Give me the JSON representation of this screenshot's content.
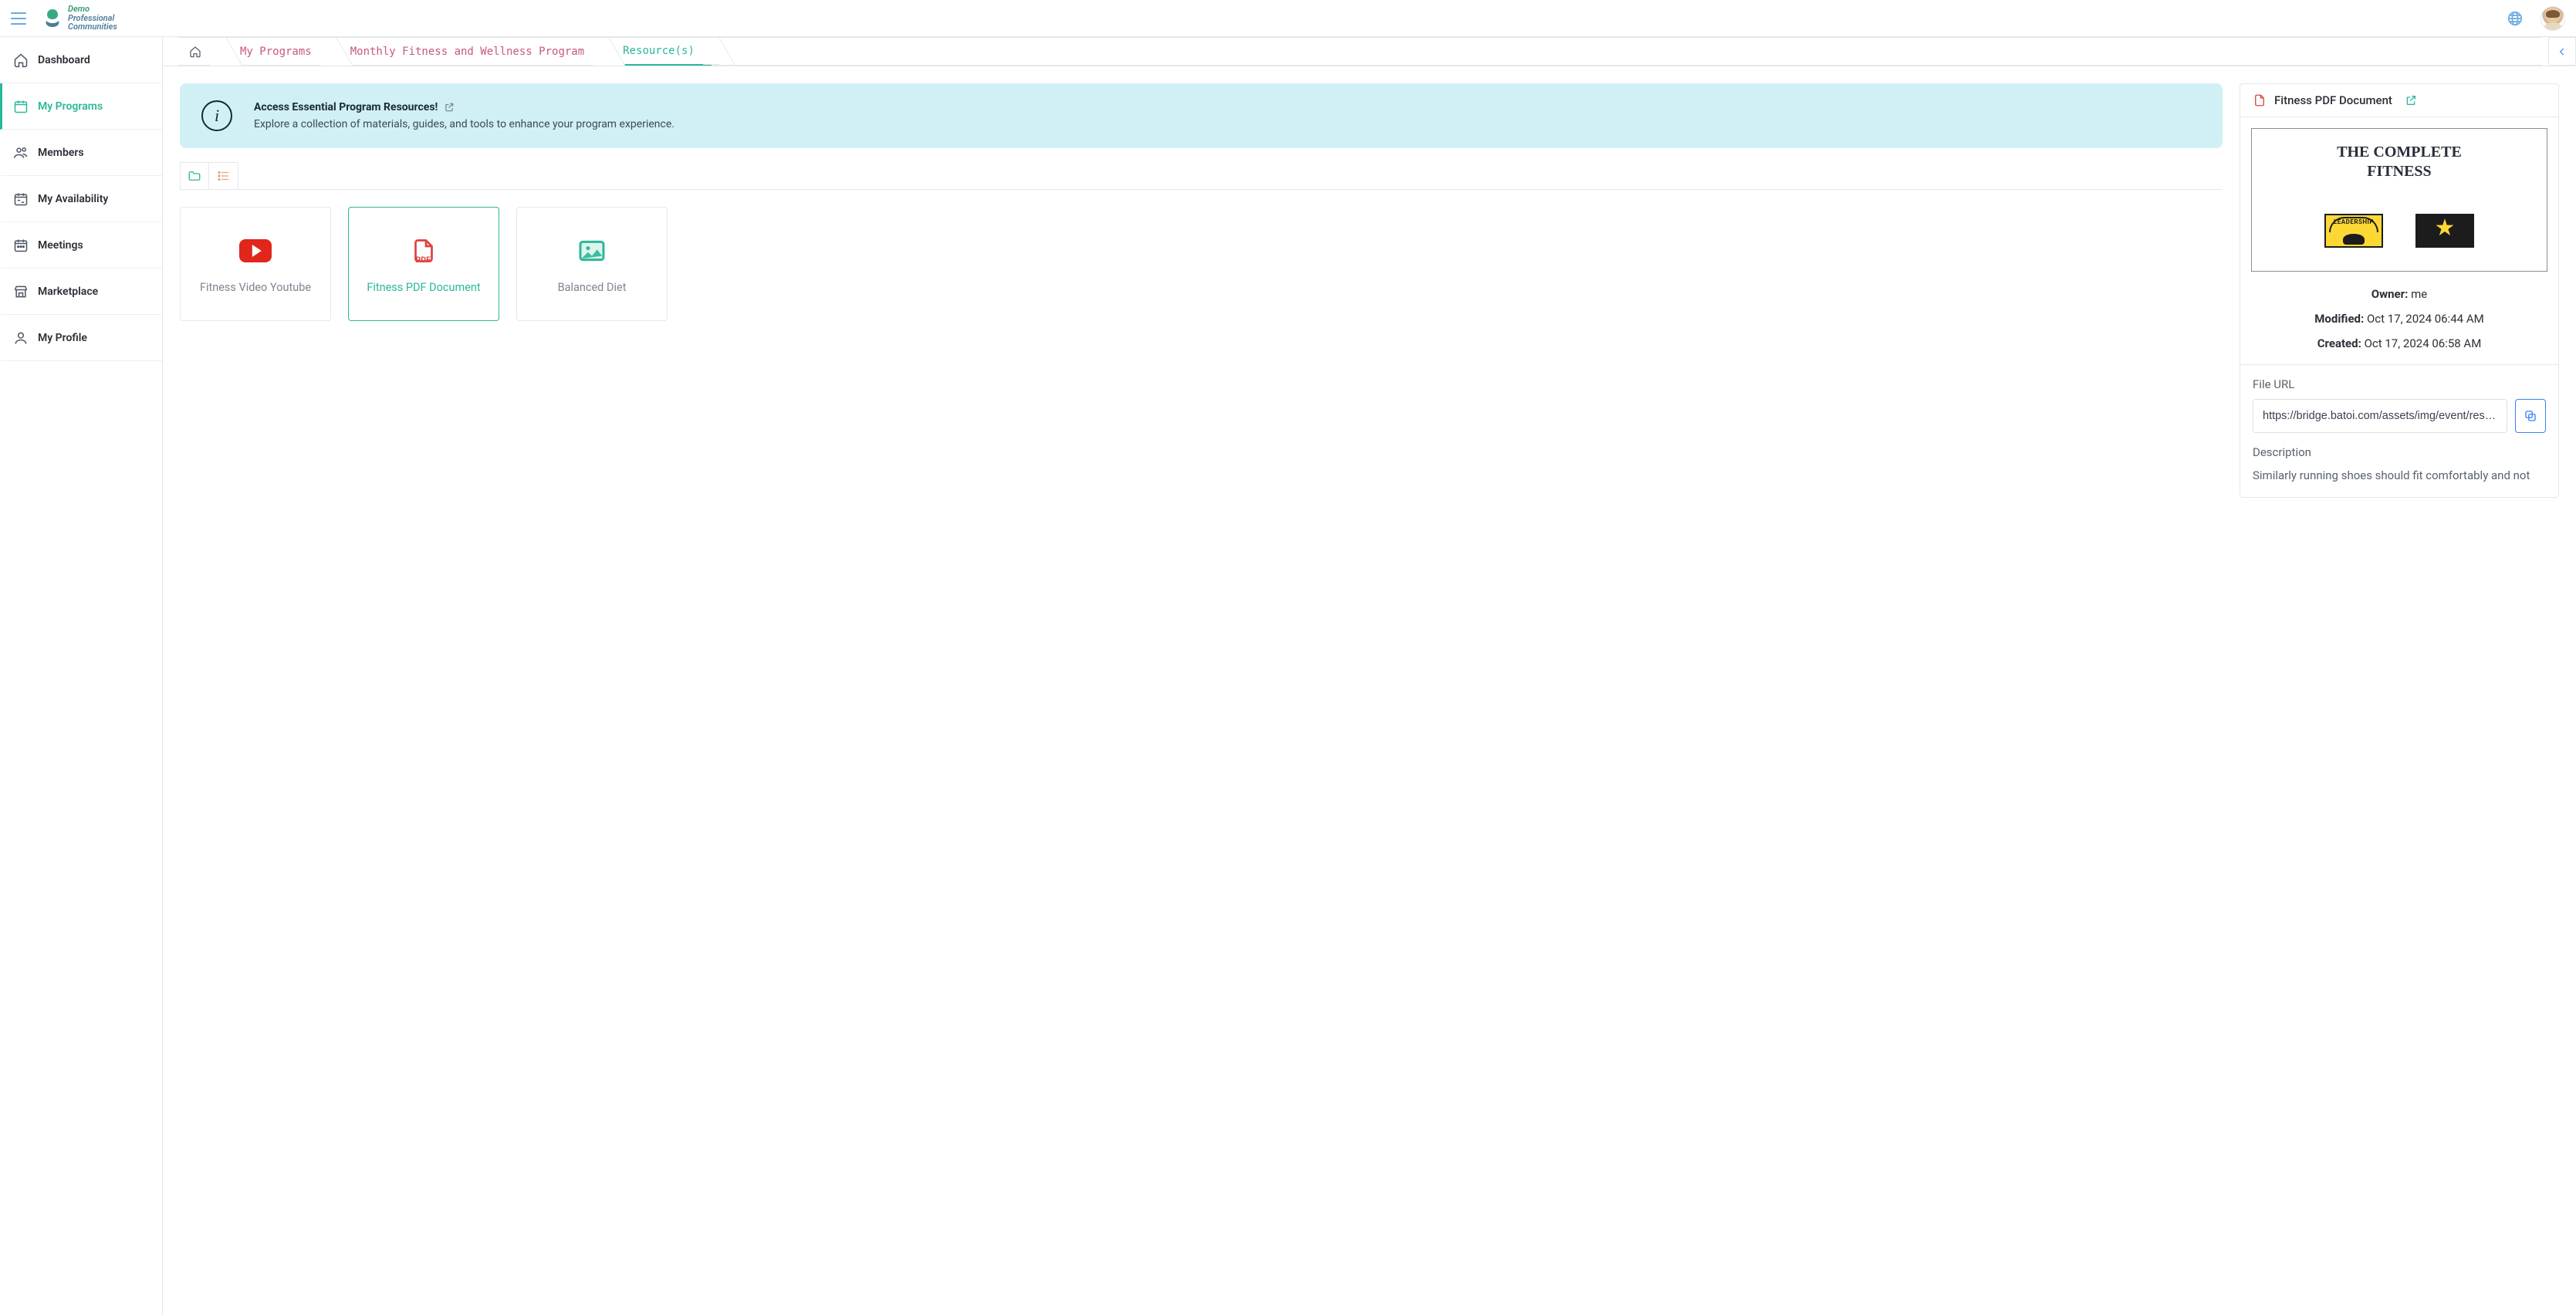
{
  "logo": {
    "line1": "Demo",
    "line2": "Professional",
    "line3": "Communities"
  },
  "sidebar": {
    "items": [
      {
        "label": "Dashboard",
        "icon": "home"
      },
      {
        "label": "My Programs",
        "icon": "calendar",
        "active": true
      },
      {
        "label": "Members",
        "icon": "users"
      },
      {
        "label": "My Availability",
        "icon": "calendar-range"
      },
      {
        "label": "Meetings",
        "icon": "calendar-days"
      },
      {
        "label": "Marketplace",
        "icon": "store"
      },
      {
        "label": "My Profile",
        "icon": "user"
      }
    ]
  },
  "breadcrumb": {
    "items": [
      {
        "label": "My Programs"
      },
      {
        "label": "Monthly Fitness and Wellness Program"
      },
      {
        "label": "Resource(s)",
        "current": true
      }
    ]
  },
  "banner": {
    "title": "Access Essential Program Resources!",
    "desc": "Explore a collection of materials, guides, and tools to enhance your program experience."
  },
  "resources": [
    {
      "label": "Fitness Video Youtube",
      "type": "youtube"
    },
    {
      "label": "Fitness PDF Document",
      "type": "pdf",
      "active": true
    },
    {
      "label": "Balanced Diet",
      "type": "image"
    }
  ],
  "detail": {
    "title": "Fitness PDF Document",
    "preview_title_line1": "THE COMPLETE",
    "preview_title_line2": "FITNESS",
    "badge_text": "LEADERSHIP",
    "owner_label": "Owner:",
    "owner_value": "me",
    "modified_label": "Modified:",
    "modified_value": "Oct 17, 2024 06:44 AM",
    "created_label": "Created:",
    "created_value": "Oct 17, 2024 06:58 AM",
    "file_url_label": "File URL",
    "file_url_value": "https://bridge.batoi.com/assets/img/event/resource",
    "description_label": "Description",
    "description_text": "Similarly running shoes should fit comfortably and not"
  }
}
